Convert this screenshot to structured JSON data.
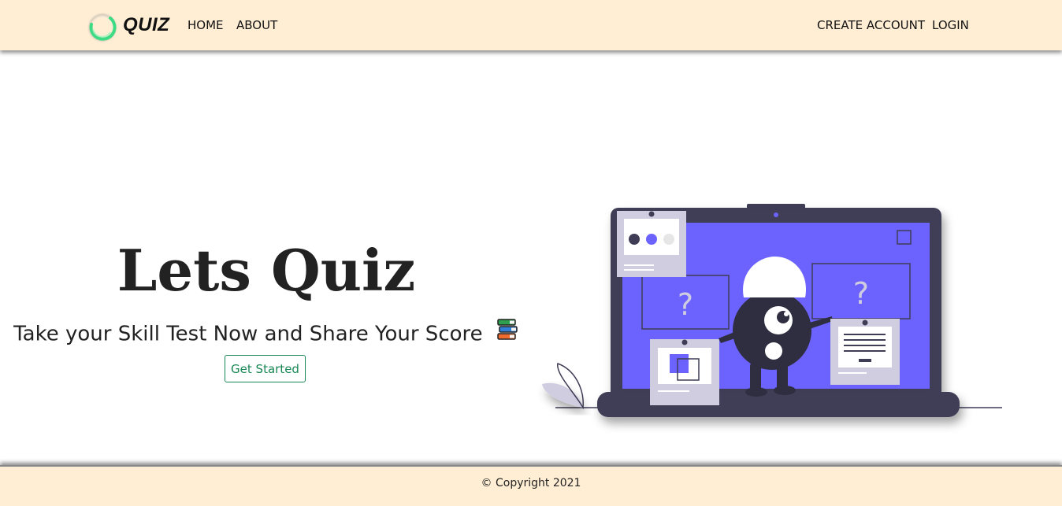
{
  "header": {
    "brand_text": "QUIZ",
    "nav_left": {
      "home": "HOME",
      "about": "ABOUT"
    },
    "nav_right": {
      "create_account": "CREATE ACCOUNT",
      "login": "LOGIN"
    },
    "logo_icon": "ring-logo-icon",
    "background_color": "#ffeed4"
  },
  "hero": {
    "title": "Lets Quiz",
    "subtitle": "Take your Skill Test Now and Share Your Score",
    "subtitle_icon": "books-icon",
    "cta_label": "Get Started",
    "cta_color": "#198754"
  },
  "illustration": {
    "name": "laptop-quiz-illustration",
    "question_mark": "?",
    "accent_color": "#6c63ff",
    "dark_color": "#3f3d56"
  },
  "footer": {
    "copyright": "© Copyright 2021"
  }
}
